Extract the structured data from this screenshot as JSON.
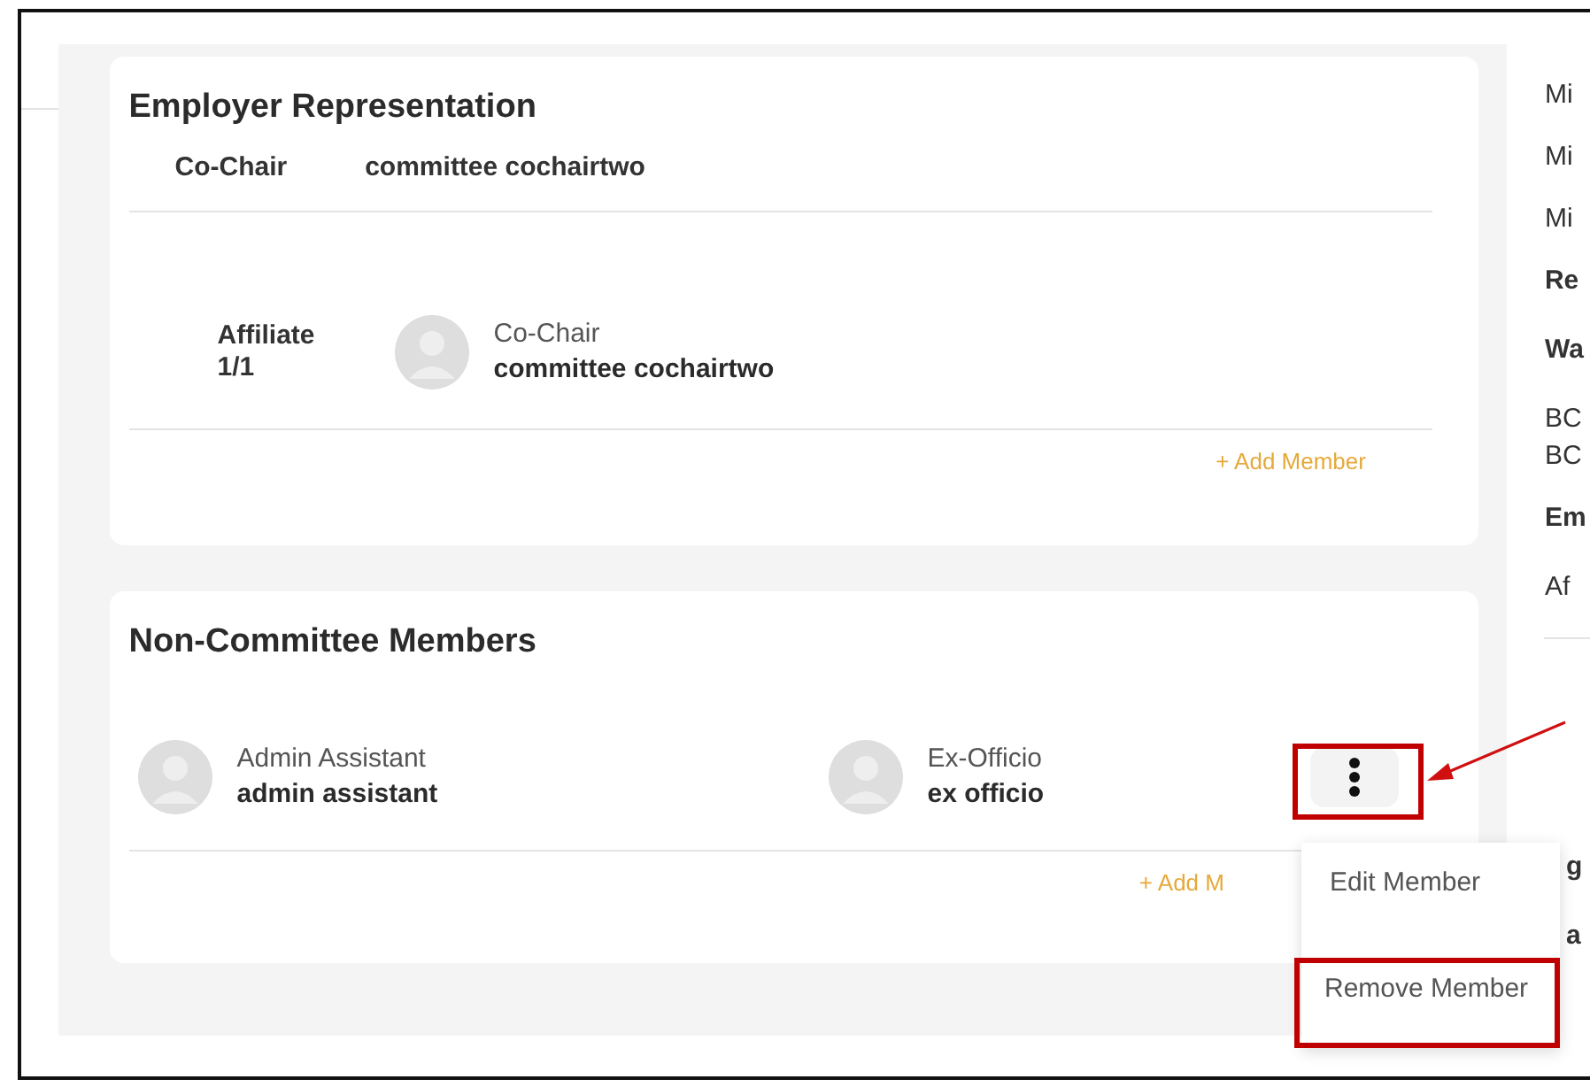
{
  "employer_representation": {
    "title": "Employer Representation",
    "summary": {
      "role": "Co-Chair",
      "name": "committee cochairtwo"
    },
    "rows": [
      {
        "group": "Affiliate",
        "count": "1/1",
        "role": "Co-Chair",
        "name": "committee cochairtwo"
      }
    ],
    "add_button": "+ Add Member"
  },
  "non_committee_members": {
    "title": "Non-Committee Members",
    "members": [
      {
        "role": "Admin Assistant",
        "name": "admin assistant",
        "has_menu": false
      },
      {
        "role": "Ex-Officio",
        "name": "ex officio",
        "has_menu": true
      }
    ],
    "add_button": "+ Add M"
  },
  "member_menu": {
    "items": [
      {
        "label": "Edit Member",
        "highlighted": false
      },
      {
        "label": "Remove Member",
        "highlighted": true
      }
    ]
  },
  "side_panel": {
    "lines": [
      {
        "text": "Mi",
        "kind": "plain"
      },
      {
        "text": "Mi",
        "kind": "plain"
      },
      {
        "text": "Mi",
        "kind": "plain"
      },
      {
        "text": "Re",
        "kind": "heading"
      },
      {
        "text": "Wa",
        "kind": "heading"
      },
      {
        "text": "BC",
        "kind": "tight"
      },
      {
        "text": "BC",
        "kind": "plain"
      },
      {
        "text": "Em",
        "kind": "heading"
      },
      {
        "text": "Af",
        "kind": "plain"
      }
    ],
    "second_card": [
      "g",
      "a"
    ]
  }
}
